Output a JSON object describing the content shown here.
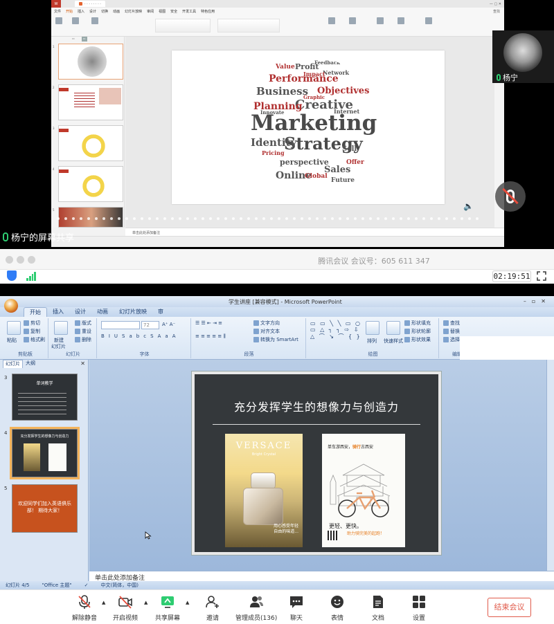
{
  "meeting": {
    "title": "腾讯会议 会议号：605 611 347",
    "timer": "02:19:51",
    "share_label": "杨宁的屏幕共享",
    "participant_name": "杨宁"
  },
  "top_share": {
    "wps_menu": [
      "文件",
      "开始",
      "插入",
      "设计",
      "切换",
      "动画",
      "幻灯片放映",
      "审阅",
      "视图",
      "安全",
      "开发工具",
      "特色应用",
      "查找"
    ],
    "notes_placeholder": "单击此处添加备注",
    "thumb_nums": [
      "1",
      "2",
      "3",
      "4",
      "5"
    ],
    "slide1_words": {
      "w_marketing": "Marketing",
      "w_strategy": "Strategy",
      "w_creative": "Creative",
      "w_planning": "Planning",
      "w_business": "Business",
      "w_performance": "Performance",
      "w_objectives": "Objectives",
      "w_identity": "Identity",
      "w_online": "Online",
      "w_sales": "Sales",
      "w_perspective": "perspective",
      "w_global": "Global",
      "w_future": "Future",
      "w_profit": "Profit",
      "w_value": "Value",
      "w_feedback": "Feedback",
      "w_internet": "Internet",
      "w_offer": "Offer",
      "w_sell": "Sell",
      "w_network": "Network",
      "w_innovate": "Innovate",
      "w_pricing": "Pricing",
      "w_impact": "Impact",
      "w_graphic": "Graphic"
    }
  },
  "ppt": {
    "window_title": "学生讲座 [兼容模式] - Microsoft PowerPoint",
    "tabs": [
      "开始",
      "插入",
      "设计",
      "动画",
      "幻灯片放映",
      "审"
    ],
    "ribbon": {
      "clipboard": {
        "paste": "粘贴",
        "cut": "剪切",
        "copy": "复制",
        "format": "格式刷",
        "caption": "剪贴板"
      },
      "slides": {
        "new_slide": "新建",
        "new_slide2": "幻灯片",
        "layout": "版式",
        "reset": "重设",
        "delete": "删除",
        "caption": "幻灯片"
      },
      "font": {
        "size": "72",
        "caption": "字体",
        "buttons": [
          "B",
          "I",
          "U",
          "S",
          "abc",
          "S",
          "Aa",
          "A"
        ]
      },
      "paragraph": {
        "text_dir": "文字方向",
        "align_text": "对齐文本",
        "smartart": "转换为 SmartArt",
        "caption": "段落"
      },
      "drawing": {
        "arrange": "排列",
        "quick_styles": "快速样式",
        "fill": "形状填充",
        "outline": "形状轮廓",
        "effects": "形状效果",
        "caption": "绘图"
      },
      "editing": {
        "find": "查找",
        "replace": "替换",
        "select": "选择",
        "caption": "编辑"
      }
    },
    "side_tabs": {
      "slides": "幻灯片",
      "outline": "大纲"
    },
    "thumb_nums": [
      "3",
      "4",
      "5"
    ],
    "thumb3_title": "单词教学",
    "thumb4_title": "充分发挥学生的想像力与创造力",
    "thumb5_title": "欢迎同学们加入英语俱乐部！ 期待大家！",
    "slide": {
      "title": "充分发挥学生的想像力与创造力",
      "poster_left": {
        "brand": "VERSACE",
        "sub": "Bright Crystal",
        "tag1": "用心感受年轻",
        "tag2": "自由的味道..."
      },
      "poster_right": {
        "headline_a": "单车游西安，",
        "headline_b": "骑行",
        "headline_c": "古西安",
        "slogan1": "更轻、更快。",
        "slogan2": "助力骑完美的起跑！"
      }
    },
    "notes_placeholder": "单击此处添加备注",
    "status": {
      "slide_count": "幻灯片 4/5",
      "theme": "\"Office 主题\"",
      "language": "中文(简体，中国)"
    }
  },
  "bottombar": {
    "unmute": "解除静音",
    "video": "开启视频",
    "share": "共享屏幕",
    "invite": "邀请",
    "members": "管理成员(136)",
    "chat": "聊天",
    "reactions": "表情",
    "docs": "文档",
    "settings": "设置",
    "end": "结束会议"
  },
  "colors": {
    "accent": "#2f7cf6",
    "end_red": "#e05a4a",
    "wps_orange": "#e3642f",
    "ok_green": "#2ecc71"
  }
}
